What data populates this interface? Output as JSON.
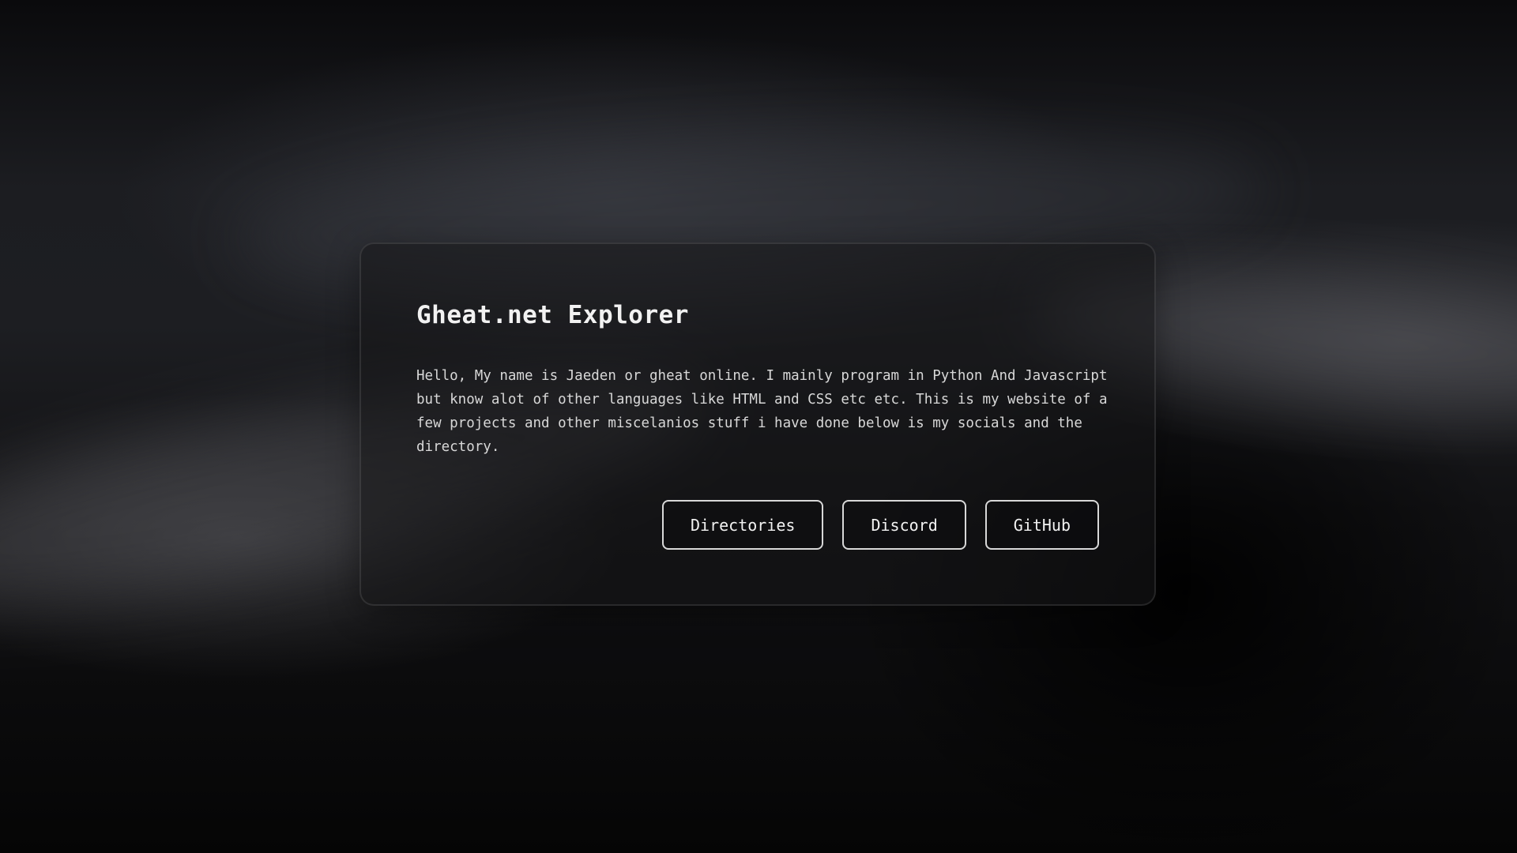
{
  "card": {
    "title": "Gheat.net Explorer",
    "description": "Hello, My name is Jaeden or gheat online. I mainly program in Python And Javascript but know alot of other languages like HTML and CSS etc etc. This is my website of a few projects and other miscelanios stuff i have done below is my socials and the directory."
  },
  "buttons": {
    "directories": "Directories",
    "discord": "Discord",
    "github": "GitHub"
  },
  "colors": {
    "background": "#0b0b0c",
    "text": "#f2f2f2",
    "button_border": "#d8d8d8"
  }
}
